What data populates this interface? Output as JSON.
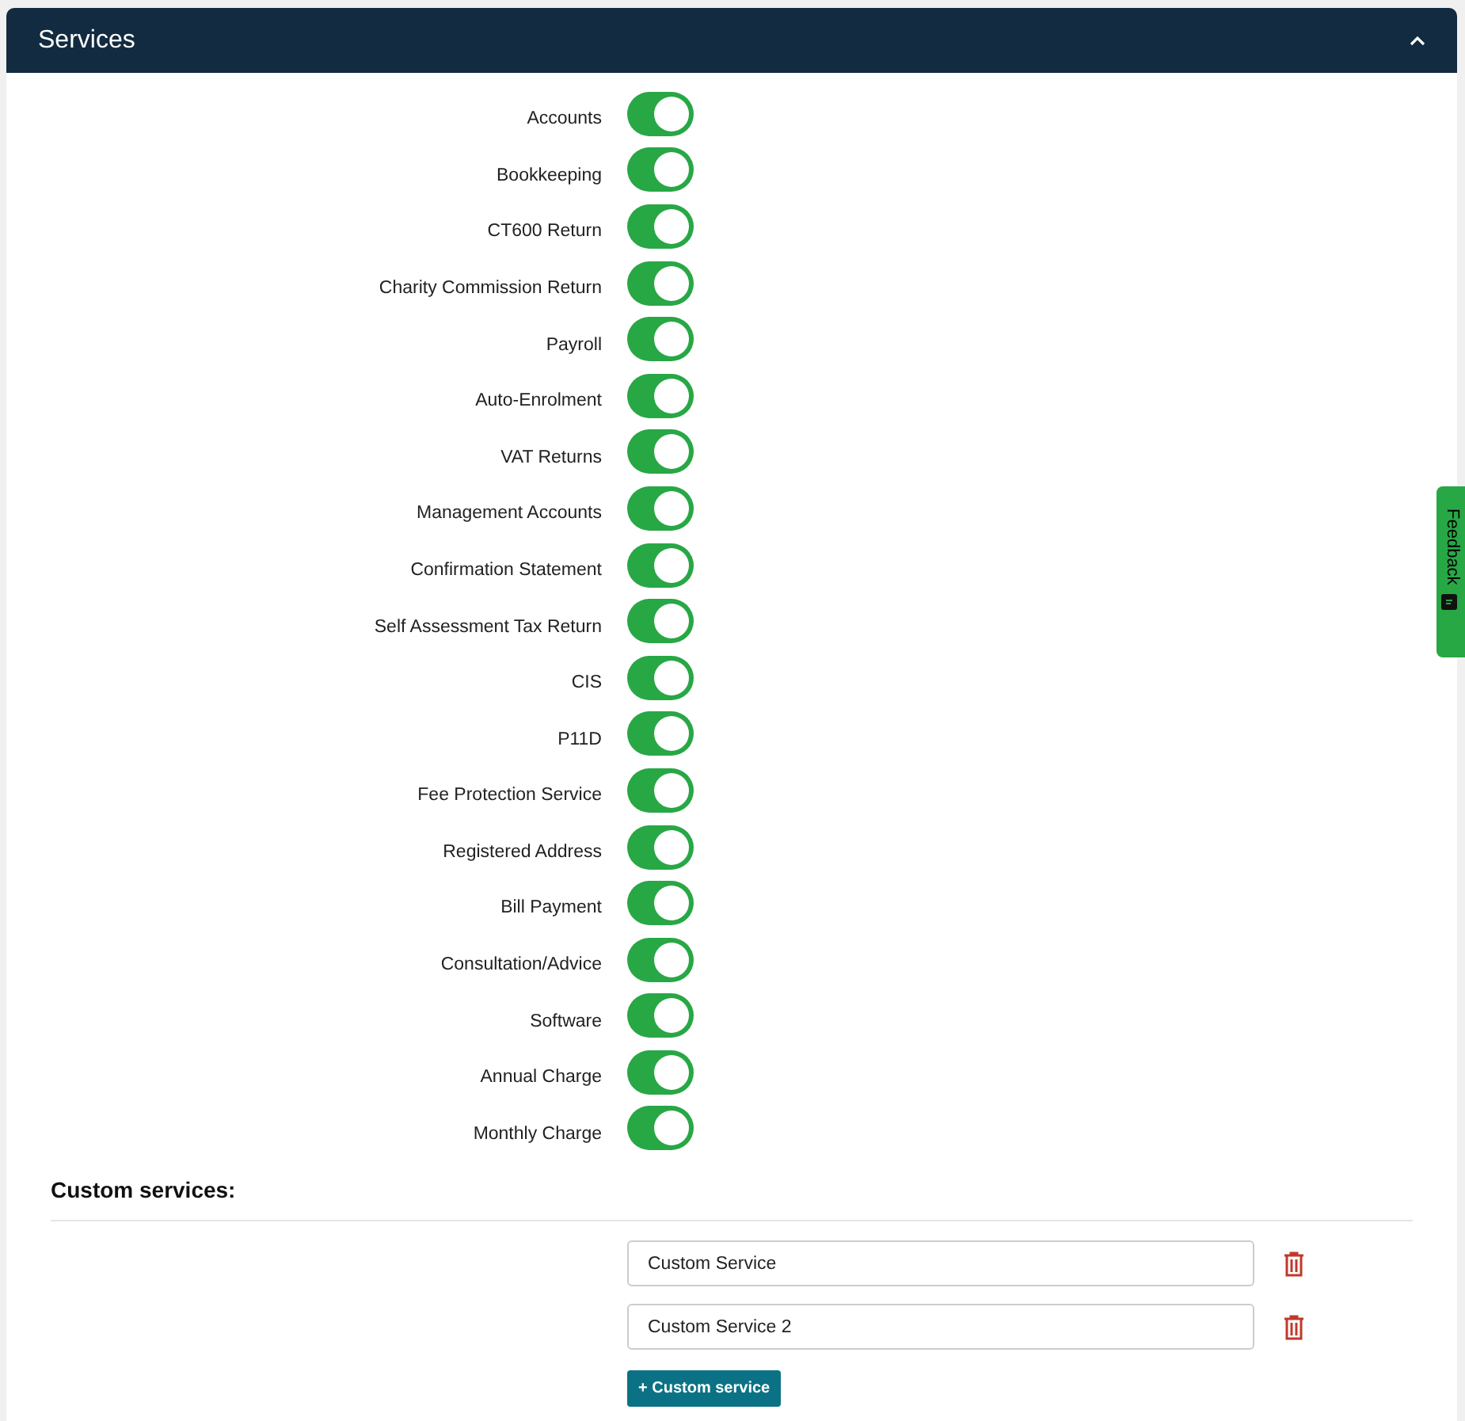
{
  "panel": {
    "title": "Services",
    "expanded": true
  },
  "services": [
    {
      "label": "Accounts",
      "on": true
    },
    {
      "label": "Bookkeeping",
      "on": true
    },
    {
      "label": "CT600 Return",
      "on": true
    },
    {
      "label": "Charity Commission Return",
      "on": true
    },
    {
      "label": "Payroll",
      "on": true
    },
    {
      "label": "Auto-Enrolment",
      "on": true
    },
    {
      "label": "VAT Returns",
      "on": true
    },
    {
      "label": "Management Accounts",
      "on": true
    },
    {
      "label": "Confirmation Statement",
      "on": true
    },
    {
      "label": "Self Assessment Tax Return",
      "on": true
    },
    {
      "label": "CIS",
      "on": true
    },
    {
      "label": "P11D",
      "on": true
    },
    {
      "label": "Fee Protection Service",
      "on": true
    },
    {
      "label": "Registered Address",
      "on": true
    },
    {
      "label": "Bill Payment",
      "on": true
    },
    {
      "label": "Consultation/Advice",
      "on": true
    },
    {
      "label": "Software",
      "on": true
    },
    {
      "label": "Annual Charge",
      "on": true
    },
    {
      "label": "Monthly Charge",
      "on": true
    }
  ],
  "custom_services": {
    "heading": "Custom services:",
    "items": [
      {
        "value": "Custom Service"
      },
      {
        "value": "Custom Service 2"
      }
    ],
    "add_button": "+ Custom service"
  },
  "feedback_tab": {
    "label": "Feedback"
  }
}
